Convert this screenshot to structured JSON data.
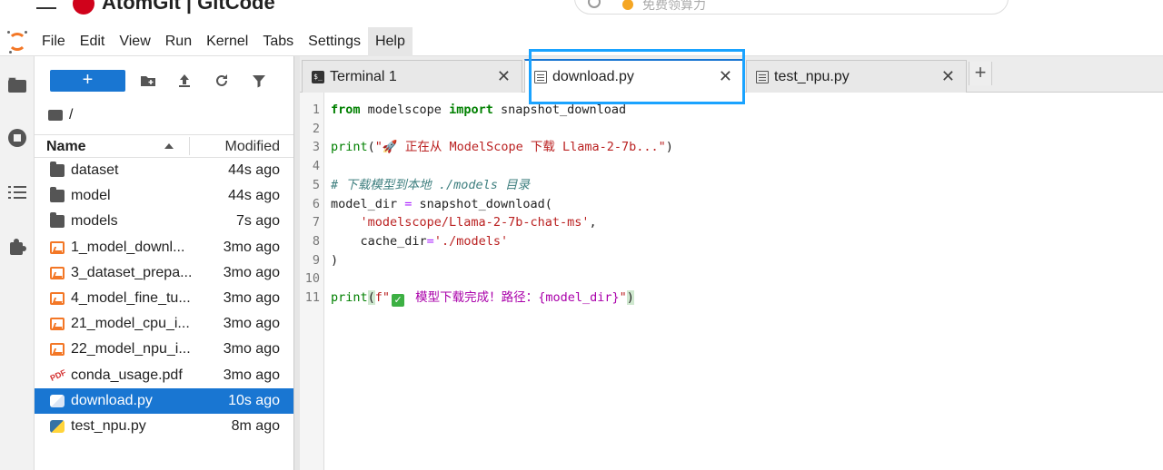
{
  "header": {
    "brand": "AtomGit | GitCode",
    "search_placeholder": "免费领算力"
  },
  "menu": [
    "File",
    "Edit",
    "View",
    "Run",
    "Kernel",
    "Tabs",
    "Settings",
    "Help"
  ],
  "menu_active": "Help",
  "file_browser": {
    "new_label": "+",
    "path": "/",
    "col_name": "Name",
    "col_modified": "Modified",
    "items": [
      {
        "name": "dataset",
        "modified": "44s ago",
        "type": "folder"
      },
      {
        "name": "model",
        "modified": "44s ago",
        "type": "folder"
      },
      {
        "name": "models",
        "modified": "7s ago",
        "type": "folder"
      },
      {
        "name": "1_model_downl...",
        "modified": "3mo ago",
        "type": "notebook"
      },
      {
        "name": "3_dataset_prepa...",
        "modified": "3mo ago",
        "type": "notebook"
      },
      {
        "name": "4_model_fine_tu...",
        "modified": "3mo ago",
        "type": "notebook"
      },
      {
        "name": "21_model_cpu_i...",
        "modified": "3mo ago",
        "type": "notebook"
      },
      {
        "name": "22_model_npu_i...",
        "modified": "3mo ago",
        "type": "notebook"
      },
      {
        "name": "conda_usage.pdf",
        "modified": "3mo ago",
        "type": "pdf"
      },
      {
        "name": "download.py",
        "modified": "10s ago",
        "type": "python",
        "selected": true
      },
      {
        "name": "test_npu.py",
        "modified": "8m ago",
        "type": "python"
      }
    ]
  },
  "tabs": [
    {
      "label": "Terminal 1",
      "icon": "terminal-icon",
      "active": false
    },
    {
      "label": "download.py",
      "icon": "file-icon",
      "active": true
    },
    {
      "label": "test_npu.py",
      "icon": "file-icon",
      "active": false
    }
  ],
  "code": {
    "line_numbers": [
      "1",
      "2",
      "3",
      "4",
      "5",
      "6",
      "7",
      "8",
      "9",
      "10",
      "11"
    ],
    "l1_from": "from",
    "l1_mod": " modelscope ",
    "l1_import": "import",
    "l1_name": " snapshot_download",
    "l3_print": "print",
    "l3_open": "(",
    "l3_str": "\"🚀 正在从 ModelScope 下载 Llama-2-7b...\"",
    "l3_close": ")",
    "l5_comment": "# 下载模型到本地 ./models 目录",
    "l6_var": "model_dir",
    "l6_eq": " = ",
    "l6_call": "snapshot_download(",
    "l7_str": "'modelscope/Llama-2-7b-chat-ms'",
    "l7_comma": ",",
    "l8_kw": "cache_dir",
    "l8_eq": "=",
    "l8_str": "'./models'",
    "l9_close": ")",
    "l11_print": "print",
    "l11_open": "(",
    "l11_f": "f\"",
    "l11_check": "✓",
    "l11_text": " 模型下载完成！路径：",
    "l11_ph": "{model_dir}",
    "l11_end": "\"",
    "l11_close": ")"
  },
  "colors": {
    "accent": "#1976d2",
    "highlight_box": "#1aa3ff",
    "jupyter_orange": "#f37726"
  }
}
